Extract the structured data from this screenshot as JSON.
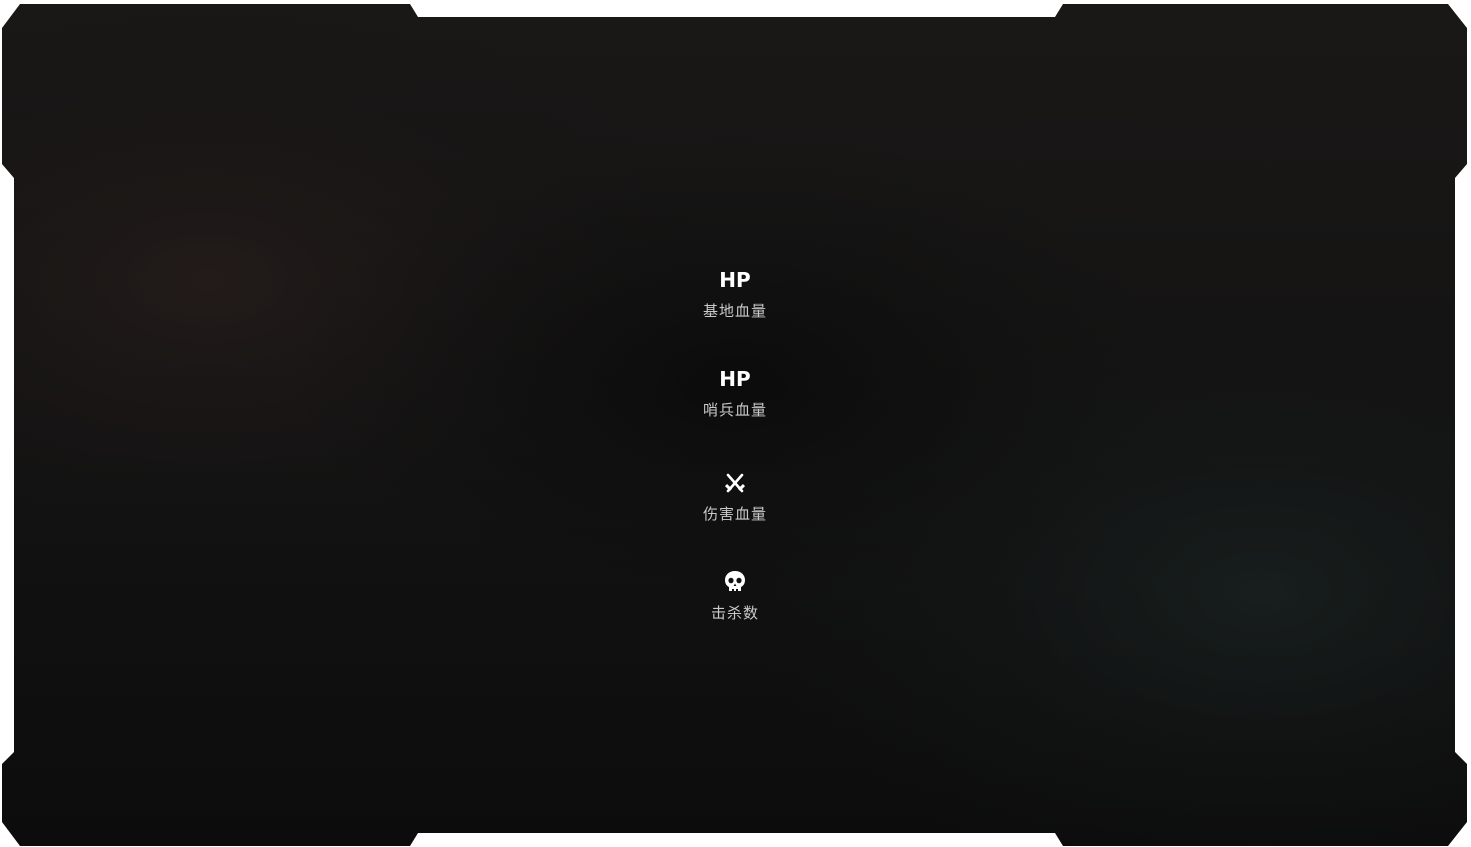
{
  "stats": [
    {
      "value": "HP",
      "label": "基地血量"
    },
    {
      "value": "HP",
      "label": "哨兵血量"
    },
    {
      "icon": "crossed-swords-icon",
      "label": "伤害血量"
    },
    {
      "icon": "skull-icon",
      "label": "击杀数"
    }
  ],
  "colors": {
    "panel": "#121212",
    "text_primary": "#ffffff",
    "text_label": "#c9c9c9"
  }
}
